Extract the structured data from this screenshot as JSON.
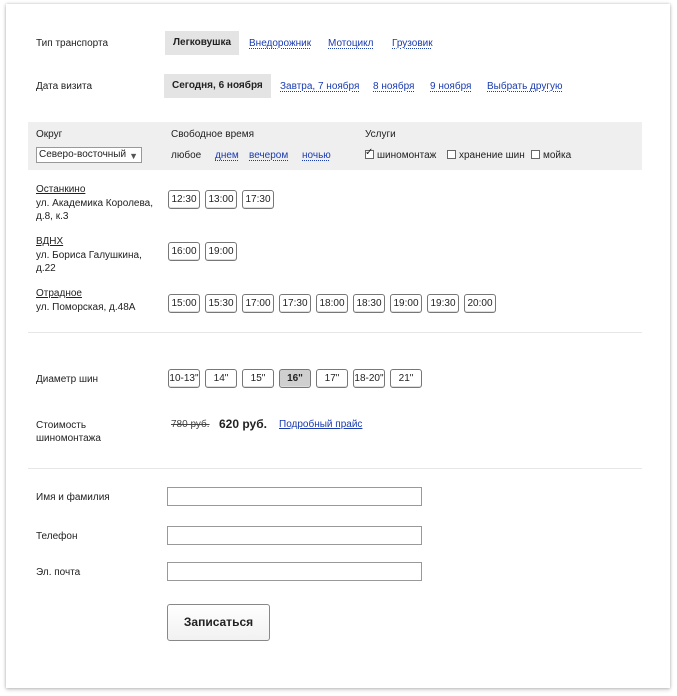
{
  "transport": {
    "label": "Тип транспорта",
    "options": [
      "Легковушка",
      "Внедорожник",
      "Мотоцикл",
      "Грузовик"
    ],
    "selected_index": 0
  },
  "visit_date": {
    "label": "Дата визита",
    "options": [
      "Сегодня, 6 ноября",
      "Завтра, 7 ноября",
      "8 ноября",
      "9 ноября",
      "Выбрать другую"
    ],
    "selected_index": 0
  },
  "filters": {
    "district_label": "Округ",
    "district_value": "Северо-восточный",
    "time_label": "Свободное время",
    "time_options": [
      "любое",
      "днем",
      "вечером",
      "ночью"
    ],
    "services_label": "Услуги",
    "services": [
      {
        "label": "шиномонтаж",
        "checked": true
      },
      {
        "label": "хранение шин",
        "checked": false
      },
      {
        "label": "мойка",
        "checked": false
      }
    ]
  },
  "locations": [
    {
      "name": "Останкино",
      "address": "ул. Академика Королева, д.8, к.3",
      "times": [
        "12:30",
        "13:00",
        "17:30"
      ]
    },
    {
      "name": "ВДНХ",
      "address": "ул. Бориса Галушкина, д.22",
      "times": [
        "16:00",
        "19:00"
      ]
    },
    {
      "name": "Отрадное",
      "address": "ул. Поморская, д.48А",
      "times": [
        "15:00",
        "15:30",
        "17:00",
        "17:30",
        "18:00",
        "18:30",
        "19:00",
        "19:30",
        "20:00"
      ]
    }
  ],
  "tire": {
    "label": "Диаметр шин",
    "sizes": [
      "10-13\"",
      "14\"",
      "15\"",
      "16\"",
      "17\"",
      "18-20\"",
      "21\""
    ],
    "selected_index": 3
  },
  "price": {
    "label": "Стоимость шиномонтажа",
    "old": "780 руб.",
    "new": "620 руб.",
    "details_link": "Подробный прайс"
  },
  "form": {
    "name_label": "Имя и фамилия",
    "phone_label": "Телефон",
    "email_label": "Эл. почта",
    "name_value": "",
    "phone_value": "",
    "email_value": "",
    "submit_label": "Записаться"
  }
}
